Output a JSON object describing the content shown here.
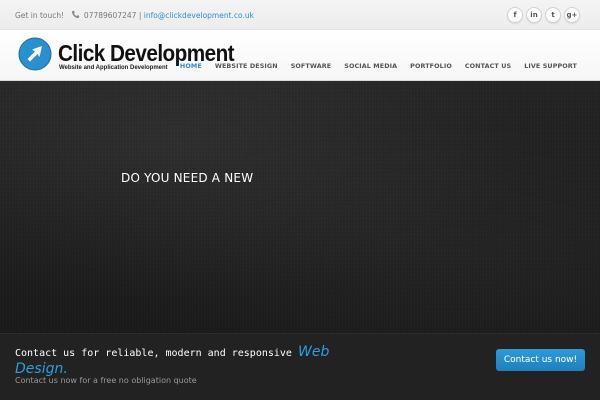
{
  "topbar": {
    "get_in_touch": "Get in touch!",
    "phone": "07789607247",
    "separator": "|",
    "email": "info@clickdevelopment.co.uk",
    "socials": [
      {
        "icon": "facebook-icon",
        "glyph": "f"
      },
      {
        "icon": "linkedin-icon",
        "glyph": "in"
      },
      {
        "icon": "twitter-icon",
        "glyph": "t"
      },
      {
        "icon": "google-plus-icon",
        "glyph": "g+"
      }
    ]
  },
  "header": {
    "logo_title": "Click Development",
    "logo_subtitle": "Website and Application Development",
    "logo_icon": "cursor-arrow-icon",
    "brand_color": "#2a8fcf",
    "nav": [
      {
        "label": "HOME",
        "active": true
      },
      {
        "label": "WEBSITE DESIGN",
        "active": false
      },
      {
        "label": "SOFTWARE",
        "active": false
      },
      {
        "label": "SOCIAL MEDIA",
        "active": false
      },
      {
        "label": "PORTFOLIO",
        "active": false
      },
      {
        "label": "CONTACT US",
        "active": false
      },
      {
        "label": "LIVE SUPPORT",
        "active": false
      }
    ]
  },
  "hero": {
    "text": "DO YOU NEED A NEW"
  },
  "cta": {
    "main_text": "Contact us for reliable, modern and responsive",
    "highlight": "Web Design.",
    "sub_text": "Contact us now for a free no obligation quote",
    "button_label": "Contact us now!",
    "accent_color": "#2a9fe0"
  }
}
